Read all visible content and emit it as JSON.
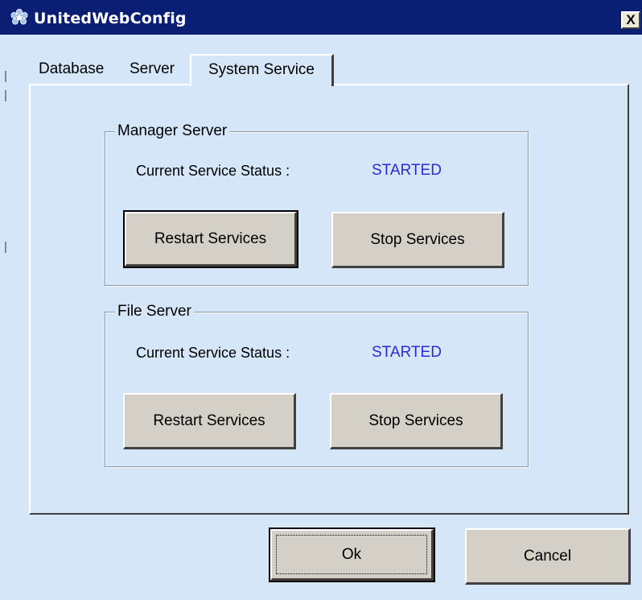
{
  "window": {
    "title": "UnitedWebConfig",
    "close_label": "X"
  },
  "tabs": [
    {
      "label": "Database",
      "selected": false
    },
    {
      "label": "Server",
      "selected": false
    },
    {
      "label": "System Service",
      "selected": true
    }
  ],
  "groups": {
    "manager": {
      "title": "Manager Server",
      "status_label": "Current Service Status :",
      "status_value": "STARTED",
      "restart_label": "Restart Services",
      "stop_label": "Stop Services"
    },
    "file": {
      "title": "File Server",
      "status_label": "Current Service Status :",
      "status_value": "STARTED",
      "restart_label": "Restart Services",
      "stop_label": "Stop Services"
    }
  },
  "footer": {
    "ok_label": "Ok",
    "cancel_label": "Cancel"
  },
  "colors": {
    "titlebar": "#0a1f73",
    "background": "#d4e6f8",
    "status_started": "#2b2bd6",
    "button_face": "#d4d0c8"
  },
  "icons": {
    "app": "gear-flower-icon",
    "close": "close-icon"
  }
}
